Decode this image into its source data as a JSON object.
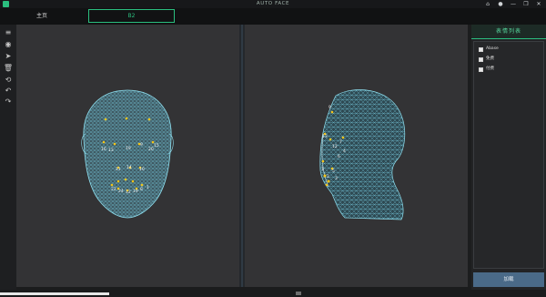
{
  "window": {
    "title": "AUTO FACE",
    "controls": [
      "home-icon",
      "user-icon",
      "minimize-icon",
      "restore-icon",
      "close-icon"
    ],
    "control_glyphs": [
      "⌂",
      "●",
      "—",
      "❐",
      "✕"
    ]
  },
  "tabs": {
    "home_label": "主页",
    "active_label": "B2"
  },
  "toolbar": {
    "tools": [
      {
        "name": "menu-icon",
        "glyph": "≡"
      },
      {
        "name": "target-icon",
        "glyph": "◉"
      },
      {
        "name": "pointer-icon",
        "glyph": "➤"
      },
      {
        "name": "trash-icon",
        "glyph": "🗑"
      },
      {
        "name": "history-icon",
        "glyph": "⟲"
      },
      {
        "name": "undo-icon",
        "glyph": "↶"
      },
      {
        "name": "redo-icon",
        "glyph": "↷"
      }
    ]
  },
  "viewports": {
    "left": {
      "view": "front",
      "landmark_labels": [
        "16",
        "13",
        "19",
        "9",
        "20",
        "15",
        "21",
        "14",
        "10",
        "22",
        "24",
        "12",
        "19",
        "8",
        "1",
        "2",
        "3",
        "4",
        "5",
        "6",
        "7",
        "11"
      ]
    },
    "right": {
      "view": "side",
      "landmark_labels": [
        "9",
        "13",
        "7",
        "12",
        "4",
        "6",
        "1",
        "5",
        "2",
        "3",
        "11",
        "10"
      ]
    }
  },
  "panel": {
    "title": "表情列表",
    "items": [
      {
        "label": "Abase",
        "checked": false
      },
      {
        "label": "免费",
        "checked": false
      },
      {
        "label": "付费",
        "checked": false
      }
    ],
    "button_label": "加载"
  },
  "status": {
    "progress": 0.2
  },
  "colors": {
    "accent": "#2bbf7f",
    "mesh": "#7ad4ea",
    "landmark": "#f5c518"
  }
}
